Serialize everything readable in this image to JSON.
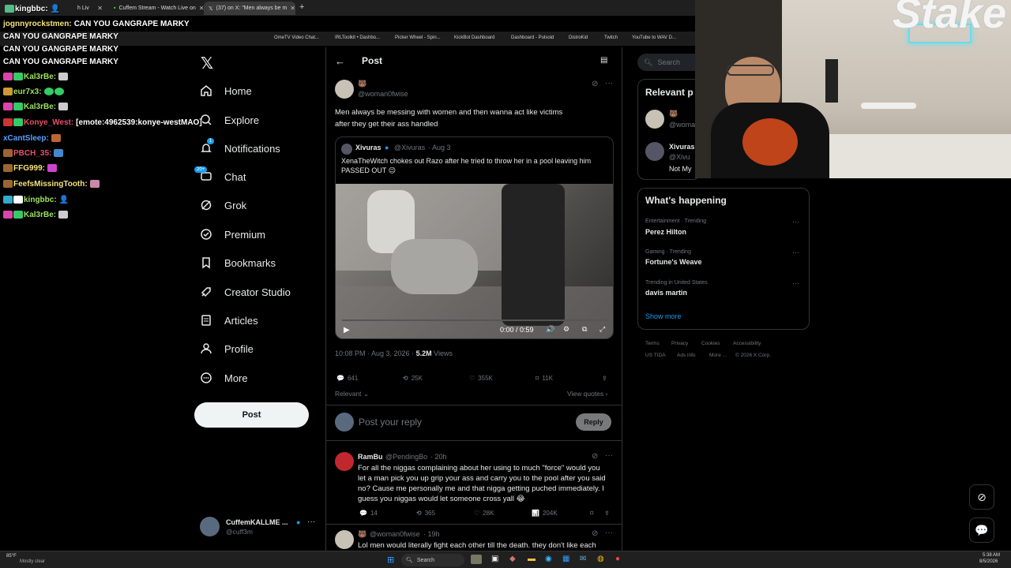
{
  "browser": {
    "tabs": [
      {
        "label": "h Liv",
        "active": false
      },
      {
        "label": "Cuffem Stream - Watch Live on",
        "active": false
      },
      {
        "label": "(37) on X: \"Men always be m",
        "active": true
      }
    ],
    "new_tab": "+",
    "bookmarks": [
      "OmeTV Video Chat...",
      "IRLToolkit • Dashbo...",
      "Picker Wheel - Spin...",
      "KickBot Dashboard",
      "Dashboard - Pulsoid",
      "DistroKid",
      "Twitch",
      "YouTube to WAV D..."
    ]
  },
  "chat_overlay": [
    {
      "user": "kingbbc:",
      "text": "",
      "color": "#ffffff"
    },
    {
      "user": "jognnyrockstmen:",
      "text": "CAN YOU GANGRAPE MARKY",
      "color": "#f6e27a"
    },
    {
      "user": "",
      "text": "CAN YOU GANGRAPE MARKY",
      "color": "#ffffff"
    },
    {
      "user": "Kal3rBe:",
      "text": "",
      "color": "#9be35d"
    },
    {
      "user": "eur7x3:",
      "text": "",
      "color": "#9be35d"
    },
    {
      "user": "Kal3rBe:",
      "text": "",
      "color": "#9be35d"
    },
    {
      "user": "Konye_West:",
      "text": "[emote:4962539:konye-westMAO]",
      "color": "#e84f6a"
    },
    {
      "user": "xCantSleep:",
      "text": "",
      "color": "#5aa0ff"
    },
    {
      "user": "PBCH_35:",
      "text": "",
      "color": "#e84f6a"
    },
    {
      "user": "FFG999:",
      "text": "",
      "color": "#f6e27a"
    },
    {
      "user": "FeefsMissingTooth:",
      "text": "",
      "color": "#f6e27a"
    },
    {
      "user": "kingbbc:",
      "text": "",
      "color": "#9be35d"
    },
    {
      "user": "Kal3rBe:",
      "text": "",
      "color": "#9be35d"
    }
  ],
  "nav": {
    "items": [
      {
        "label": "Home",
        "icon": "home-icon"
      },
      {
        "label": "Explore",
        "icon": "search-icon"
      },
      {
        "label": "Notifications",
        "icon": "bell-icon",
        "badge": "1"
      },
      {
        "label": "Chat",
        "icon": "chat-icon",
        "badge": "20+"
      },
      {
        "label": "Grok",
        "icon": "grok-icon"
      },
      {
        "label": "Premium",
        "icon": "premium-icon"
      },
      {
        "label": "Bookmarks",
        "icon": "bookmark-icon"
      },
      {
        "label": "Creator Studio",
        "icon": "rocket-icon"
      },
      {
        "label": "Articles",
        "icon": "article-icon"
      },
      {
        "label": "Profile",
        "icon": "person-icon"
      },
      {
        "label": "More",
        "icon": "more-icon"
      }
    ],
    "post_button": "Post",
    "account": {
      "name": "CuffemKALLME ...",
      "handle": "@cuff3m"
    }
  },
  "post": {
    "header": "Post",
    "author_handle": "@woman0fwise",
    "text_line1": "Men always be messing with women and then wanna act like victims",
    "text_line2": "after they get their ass handled",
    "quote": {
      "name": "Xivuras",
      "handle": "@Xivuras",
      "date": "· Aug 3",
      "text_line1": "XenaTheWitch chokes out Razo after he tried to throw her in a pool leaving him",
      "text_line2": "PASSED OUT 😉",
      "video_time": "0:00 / 0:59",
      "video_progress": 0
    },
    "timestamp": "10:08 PM · Aug 3, 2026 ·",
    "views_count": "5.2M",
    "views_label": "Views",
    "replies": "641",
    "reposts": "25K",
    "likes": "355K",
    "bookmarks": "11K",
    "sort_label": "Relevant",
    "view_quotes": "View quotes",
    "reply_placeholder": "Post your reply",
    "reply_button": "Reply"
  },
  "replies": [
    {
      "name": "RamBu",
      "handle": "@PendingBo",
      "time": "· 20h",
      "lines": [
        "For all the niggas complaining about her using to much \"force\" would you",
        "let a man pick you up grip your ass and carry you to the pool after you said",
        "no? Cause me personally me and that nigga getting puched immediately. I",
        "guess you niggas would let someone cross yall 😂"
      ],
      "replies": "14",
      "reposts": "365",
      "likes": "28K",
      "views": "204K"
    },
    {
      "name": "",
      "handle": "@woman0fwise",
      "time": "· 19h",
      "lines": [
        "Lol men would literally fight each other till the death. they don't like each"
      ]
    }
  ],
  "right": {
    "search_placeholder": "Search",
    "relevant_title": "Relevant p",
    "relevant": [
      {
        "name": "",
        "handle": "@woma"
      },
      {
        "name": "Xivuras",
        "handle": "@Xivu",
        "bio": "Not My"
      }
    ],
    "happening_title": "What's happening",
    "trends": [
      {
        "category": "Entertainment · Trending",
        "name": "Perez Hilton"
      },
      {
        "category": "Gaming · Trending",
        "name": "Fortune's Weave"
      },
      {
        "category": "Trending in United States",
        "name": "davis martin"
      }
    ],
    "show_more": "Show more",
    "footer_line1": [
      "Terms",
      "Privacy",
      "Cookies",
      "Accessibility"
    ],
    "footer_line2": [
      "US TIDA",
      "Ads info",
      "More ...",
      "© 2026 X Corp."
    ]
  },
  "webcam": {
    "brand": "Stake"
  },
  "taskbar": {
    "weather_temp": "85°F",
    "weather_desc": "Mostly clear",
    "search_label": "Search",
    "time": "5:38 AM",
    "date": "8/5/2026"
  }
}
